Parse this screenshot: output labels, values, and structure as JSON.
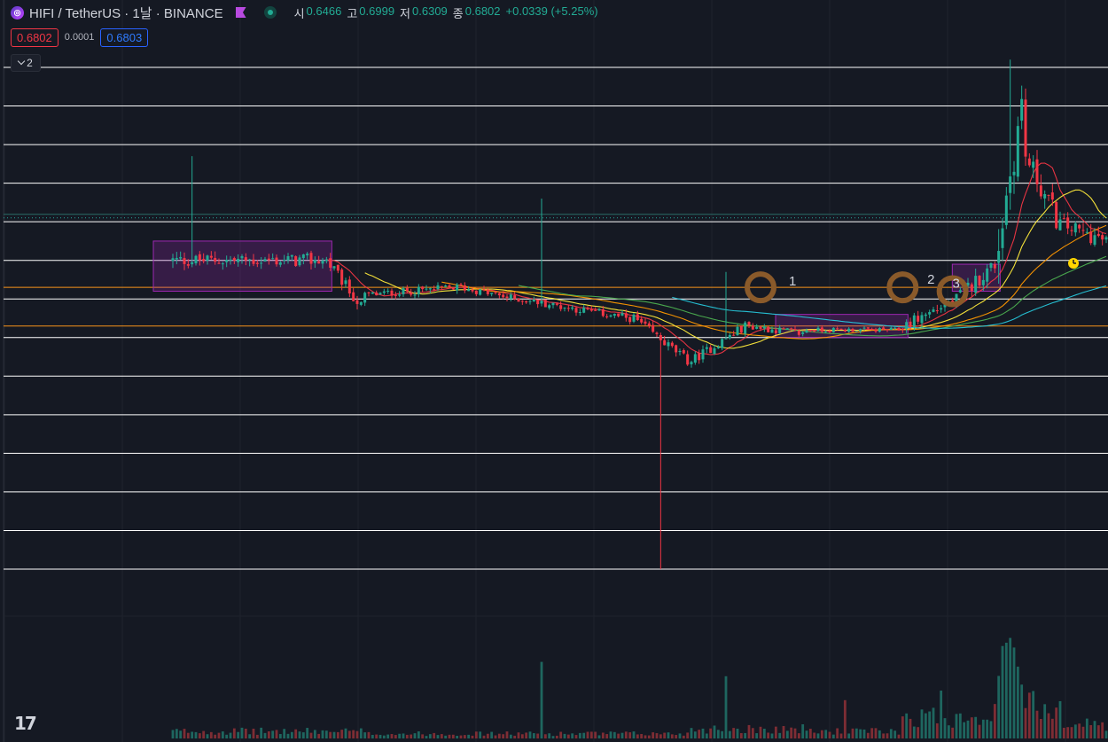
{
  "header": {
    "title": "HIFI / TetherUS · 1날 · BINANCE",
    "open_label": "시",
    "open": "0.6466",
    "high_label": "고",
    "high": "0.6999",
    "low_label": "저",
    "low": "0.6309",
    "close_label": "종",
    "close": "0.6802",
    "change": "+0.0339 (+5.25%)"
  },
  "order": {
    "sell": "0.6802",
    "spread": "0.0001",
    "buy": "0.6803"
  },
  "indicators": {
    "collapsed_count": "2"
  },
  "brand": {
    "logo_text": "17"
  },
  "colors": {
    "background": "#151923",
    "up": "#22ab94",
    "down": "#f23645",
    "sell": "#f23645",
    "buy": "#2962ff",
    "box": "#9c27b0",
    "circle": "#8a5a2a",
    "white_line": "#ffffff",
    "orange_line": "#f7931a"
  },
  "chart_data": {
    "type": "candlestick",
    "symbol": "HIFI / TetherUS",
    "interval": "1날",
    "exchange": "BINANCE",
    "ohlc_last": {
      "open": 0.6466,
      "high": 0.6999,
      "low": 0.6309,
      "close": 0.6802,
      "change": 0.0339,
      "change_pct": 5.25
    },
    "price_range": [
      -0.15,
      1.25
    ],
    "log_scale": false,
    "grid": true,
    "segments": [
      {
        "from": 0,
        "to": 40,
        "start": 0.7,
        "end": 0.7,
        "vol": 0.018,
        "volume": 3
      },
      {
        "from": 40,
        "to": 50,
        "start": 0.7,
        "end": 0.58,
        "vol": 0.015,
        "volume": 3
      },
      {
        "from": 50,
        "to": 75,
        "start": 0.61,
        "end": 0.63,
        "vol": 0.01,
        "volume": 2
      },
      {
        "from": 75,
        "to": 90,
        "start": 0.63,
        "end": 0.6,
        "vol": 0.01,
        "volume": 2
      },
      {
        "from": 90,
        "to": 120,
        "start": 0.6,
        "end": 0.55,
        "vol": 0.01,
        "volume": 2
      },
      {
        "from": 120,
        "to": 135,
        "start": 0.55,
        "end": 0.44,
        "vol": 0.012,
        "volume": 2
      },
      {
        "from": 135,
        "to": 150,
        "start": 0.44,
        "end": 0.53,
        "vol": 0.012,
        "volume": 4
      },
      {
        "from": 150,
        "to": 165,
        "start": 0.53,
        "end": 0.51,
        "vol": 0.01,
        "volume": 4
      },
      {
        "from": 165,
        "to": 190,
        "start": 0.52,
        "end": 0.52,
        "vol": 0.006,
        "volume": 3
      },
      {
        "from": 190,
        "to": 205,
        "start": 0.53,
        "end": 0.6,
        "vol": 0.015,
        "volume": 9
      },
      {
        "from": 205,
        "to": 215,
        "start": 0.61,
        "end": 0.69,
        "vol": 0.02,
        "volume": 10
      },
      {
        "from": 215,
        "to": 222,
        "start": 0.75,
        "end": 1.1,
        "vol": 0.06,
        "volume": 28
      },
      {
        "from": 222,
        "to": 232,
        "start": 0.97,
        "end": 0.79,
        "vol": 0.03,
        "volume": 14
      },
      {
        "from": 232,
        "to": 244,
        "start": 0.79,
        "end": 0.75,
        "vol": 0.02,
        "volume": 6
      }
    ],
    "spikes": [
      {
        "i": 5,
        "high": 0.97
      },
      {
        "i": 96,
        "high": 0.86
      },
      {
        "i": 127,
        "low": -0.1
      },
      {
        "i": 144,
        "high": 0.67
      },
      {
        "i": 218,
        "high": 1.22
      }
    ],
    "volume_spikes": [
      {
        "i": 96,
        "volume": 32
      },
      {
        "i": 144,
        "volume": 26
      },
      {
        "i": 175,
        "volume": 16
      },
      {
        "i": 200,
        "volume": 20
      },
      {
        "i": 217,
        "volume": 40
      },
      {
        "i": 218,
        "volume": 42
      },
      {
        "i": 219,
        "volume": 38
      },
      {
        "i": 220,
        "volume": 30
      }
    ],
    "horizontal_levels": {
      "white": [
        1.2,
        1.1,
        1.0,
        0.9,
        0.8,
        0.7,
        0.6,
        0.5,
        0.4,
        0.3,
        0.2,
        0.1,
        0.0,
        -0.1
      ],
      "orange": [
        0.63,
        0.53
      ],
      "teal_dotted": [
        0.81
      ]
    },
    "boxes": [
      {
        "from": 0,
        "to": 40,
        "low": 0.62,
        "high": 0.75
      },
      {
        "from": 162,
        "to": 190,
        "low": 0.5,
        "high": 0.56
      },
      {
        "from": 208,
        "to": 214,
        "low": 0.62,
        "high": 0.69
      }
    ],
    "markers": [
      {
        "i": 153,
        "price": 0.63,
        "label": "1"
      },
      {
        "i": 190,
        "price": 0.63,
        "label": "2"
      },
      {
        "i": 203,
        "price": 0.62,
        "label": "3"
      }
    ],
    "moving_averages": [
      {
        "period": 10,
        "color": "#f23645"
      },
      {
        "period": 20,
        "color": "#ffeb3b"
      },
      {
        "period": 40,
        "color": "#ff9800"
      },
      {
        "period": 60,
        "color": "#4caf50"
      },
      {
        "period": 100,
        "color": "#26c6da"
      }
    ]
  }
}
